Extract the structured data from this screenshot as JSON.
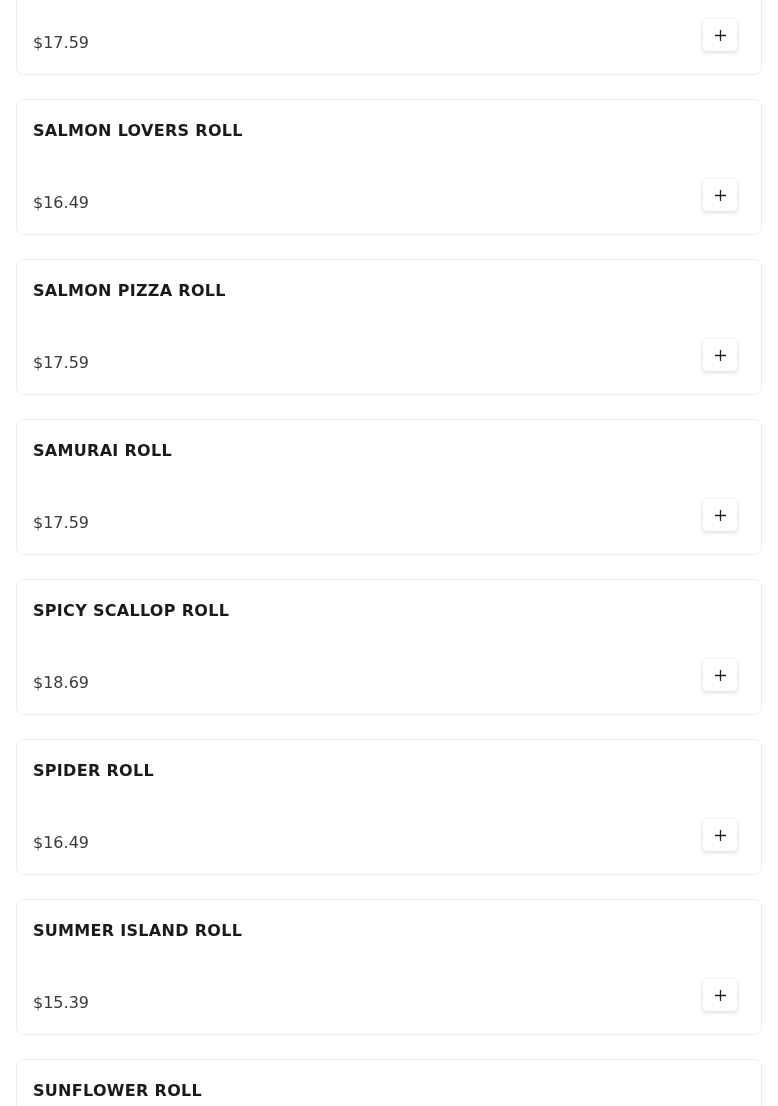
{
  "menu_items": [
    {
      "price": "$17.59"
    },
    {
      "name": "SALMON LOVERS ROLL",
      "price": "$16.49"
    },
    {
      "name": "SALMON PIZZA ROLL",
      "price": "$17.59"
    },
    {
      "name": "SAMURAI ROLL",
      "price": "$17.59"
    },
    {
      "name": "SPICY SCALLOP ROLL",
      "price": "$18.69"
    },
    {
      "name": "SPIDER ROLL",
      "price": "$16.49"
    },
    {
      "name": "SUMMER ISLAND ROLL",
      "price": "$15.39"
    },
    {
      "name": "SUNFLOWER ROLL"
    }
  ]
}
